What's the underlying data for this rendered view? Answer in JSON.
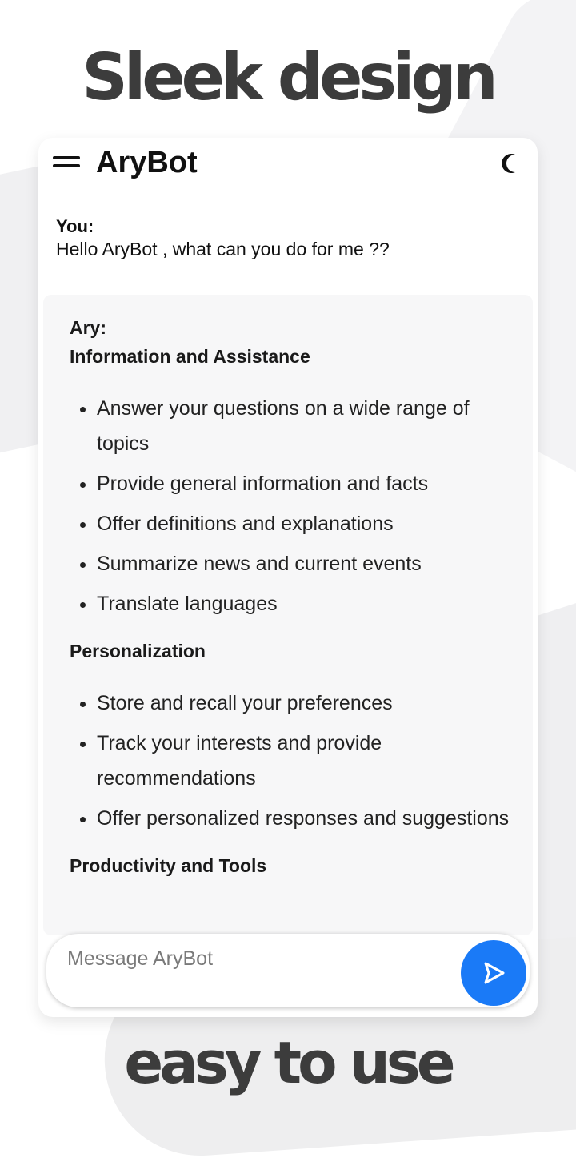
{
  "headline_top": "Sleek design",
  "headline_bottom": "easy to use",
  "app": {
    "title": "AryBot",
    "menu_icon": "hamburger-menu-icon",
    "theme_icon": "moon-icon"
  },
  "user_message": {
    "label": "You:",
    "text": "Hello AryBot , what can you do for me ??"
  },
  "bot_message": {
    "label": "Ary:",
    "sections": [
      {
        "title": "Information and Assistance",
        "items": [
          "Answer your questions on a wide range of topics",
          "Provide general information and facts",
          "Offer definitions and explanations",
          "Summarize news and current events",
          "Translate languages"
        ]
      },
      {
        "title": "Personalization",
        "items": [
          "Store and recall your preferences",
          "Track your interests and provide recommendations",
          "Offer personalized responses and suggestions"
        ]
      },
      {
        "title": "Productivity and Tools",
        "items": []
      }
    ]
  },
  "composer": {
    "placeholder": "Message AryBot",
    "send_icon": "send-icon"
  },
  "colors": {
    "accent": "#1a7af7",
    "headline": "#3c3c3c",
    "bot_bubble": "#f7f7f8"
  }
}
